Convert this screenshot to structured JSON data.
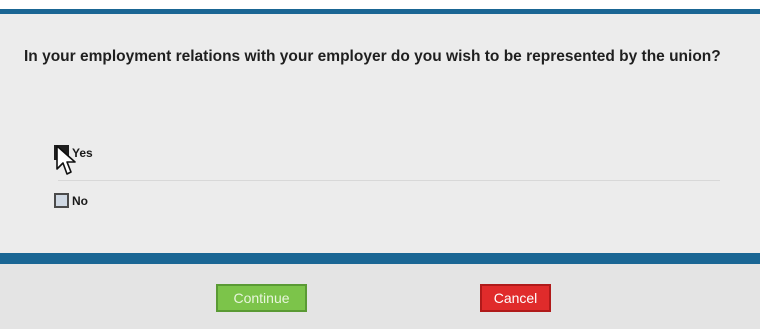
{
  "question": {
    "text": "In your employment relations with your employer do you wish to be represented by the union?"
  },
  "options": [
    {
      "label": "Yes",
      "checked": true
    },
    {
      "label": "No",
      "checked": false
    }
  ],
  "buttons": {
    "continue_label": "Continue",
    "cancel_label": "Cancel"
  },
  "colors": {
    "accent_rule": "#1a6694",
    "continue_button": "#7cc44a",
    "cancel_button": "#e02b2b"
  },
  "icons": {
    "cursor": "mouse-pointer-icon"
  }
}
